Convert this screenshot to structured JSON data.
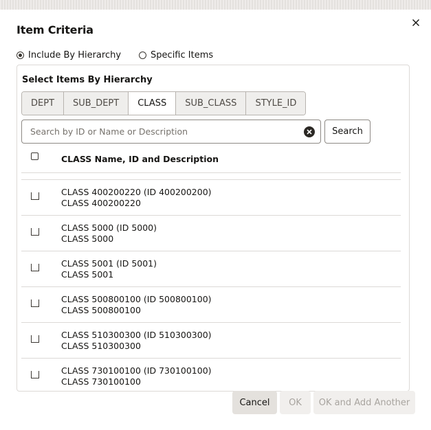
{
  "dialog": {
    "title": "Item Criteria",
    "close_label": "×"
  },
  "selection_mode": {
    "options": [
      {
        "label": "Include By Hierarchy",
        "checked": true
      },
      {
        "label": "Specific Items",
        "checked": false
      }
    ]
  },
  "hierarchy": {
    "label": "Select Items By Hierarchy",
    "tabs": [
      {
        "label": "DEPT",
        "active": false
      },
      {
        "label": "SUB_DEPT",
        "active": false
      },
      {
        "label": "CLASS",
        "active": true
      },
      {
        "label": "SUB_CLASS",
        "active": false
      },
      {
        "label": "STYLE_ID",
        "active": false
      }
    ]
  },
  "search": {
    "placeholder": "Search by ID or Name or Description",
    "value": "",
    "button_label": "Search"
  },
  "list": {
    "header": "CLASS Name, ID and Description",
    "rows": [
      {
        "line1": "CLASS 400200220 (ID 400200200)",
        "line2": "CLASS 400200220"
      },
      {
        "line1": "CLASS 5000 (ID 5000)",
        "line2": "CLASS 5000"
      },
      {
        "line1": "CLASS 5001 (ID 5001)",
        "line2": "CLASS 5001"
      },
      {
        "line1": "CLASS 500800100 (ID 500800100)",
        "line2": "CLASS 500800100"
      },
      {
        "line1": "CLASS 510300300 (ID 510300300)",
        "line2": "CLASS 510300300"
      },
      {
        "line1": "CLASS 730100100 (ID 730100100)",
        "line2": "CLASS 730100100"
      }
    ]
  },
  "footer": {
    "cancel_label": "Cancel",
    "ok_label": "OK",
    "ok_add_label": "OK and Add Another"
  }
}
